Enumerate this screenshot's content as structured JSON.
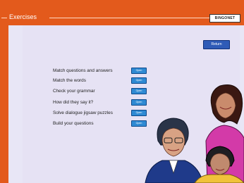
{
  "header": {
    "title": "Exercises",
    "brand": "BINGONET"
  },
  "buttons": {
    "return_label": "Return",
    "open_label": "Open"
  },
  "exercises": [
    {
      "label": "Match questions and answers"
    },
    {
      "label": "Match the words"
    },
    {
      "label": "Check your grammar"
    },
    {
      "label": "How did they say it?"
    },
    {
      "label": "Solve dialogue jigsaw puzzles"
    },
    {
      "label": "Build your questions"
    }
  ],
  "colors": {
    "accent": "#e35a1c",
    "panel": "#e6e2f4",
    "button": "#2f8ad3"
  }
}
